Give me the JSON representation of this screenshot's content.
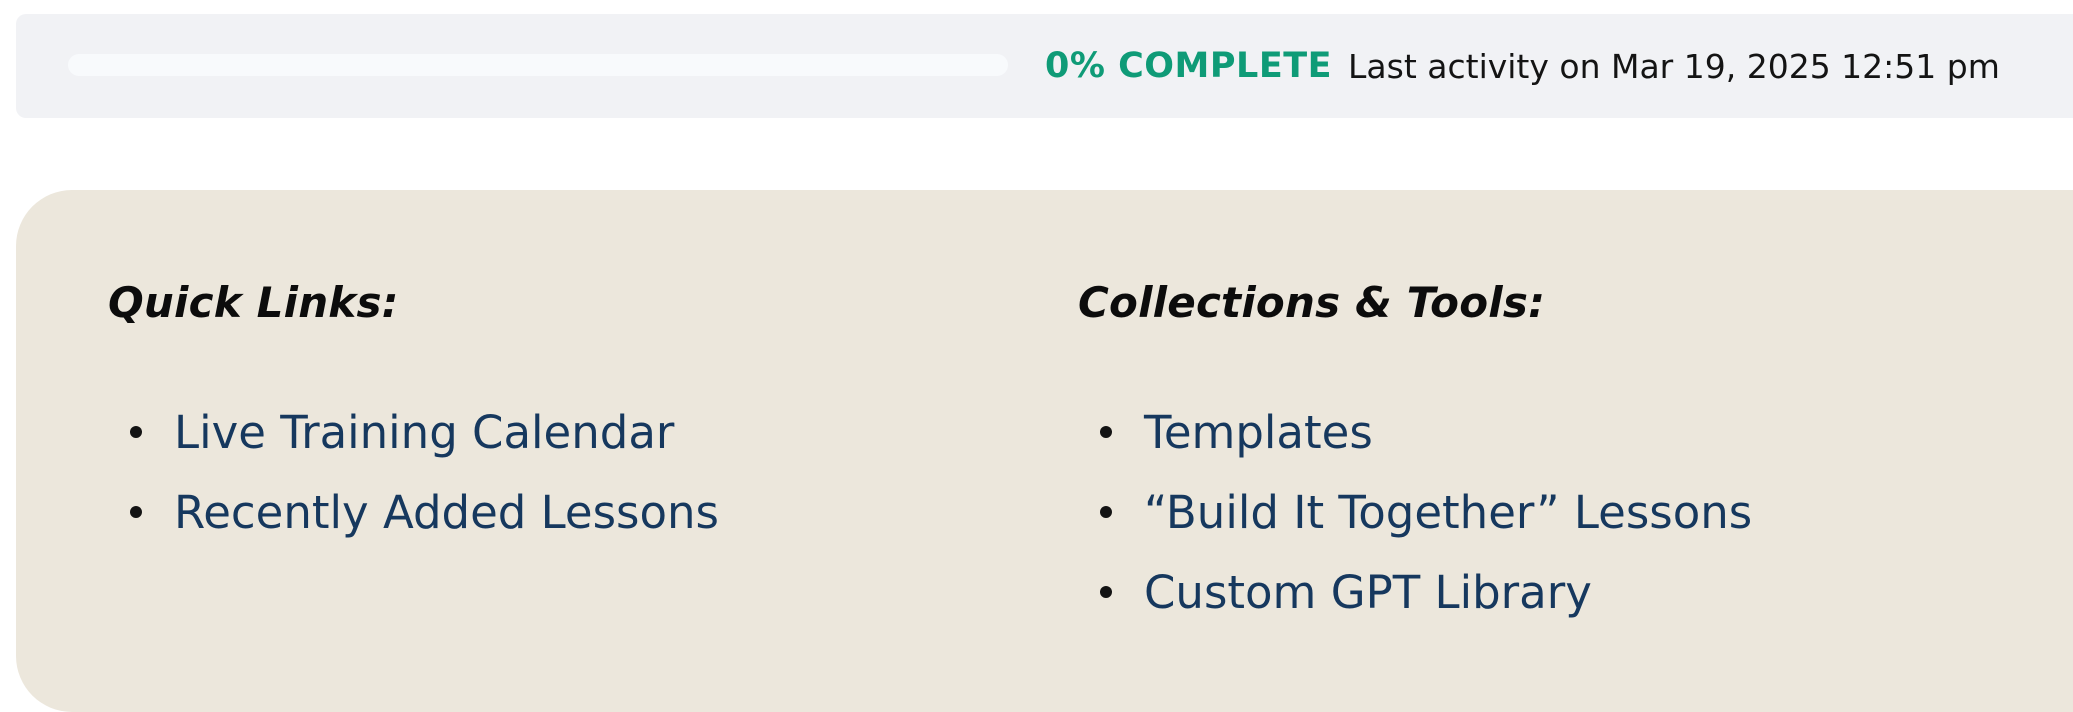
{
  "progress": {
    "percent_complete": 0,
    "percent_label": "0% COMPLETE",
    "activity_text": "Last activity on Mar 19, 2025 12:51 pm",
    "accent_color": "#0f9b77"
  },
  "quick_links": {
    "heading": "Quick Links:",
    "items": [
      {
        "label": "Live Training Calendar"
      },
      {
        "label": "Recently Added Lessons"
      }
    ]
  },
  "collections_tools": {
    "heading": "Collections & Tools:",
    "items": [
      {
        "label": "Templates"
      },
      {
        "label": "“Build It Together” Lessons"
      },
      {
        "label": "Custom GPT Library"
      }
    ]
  },
  "colors": {
    "link": "#16385e",
    "panel_background": "#ece7dc",
    "progress_background": "#f1f2f5"
  }
}
